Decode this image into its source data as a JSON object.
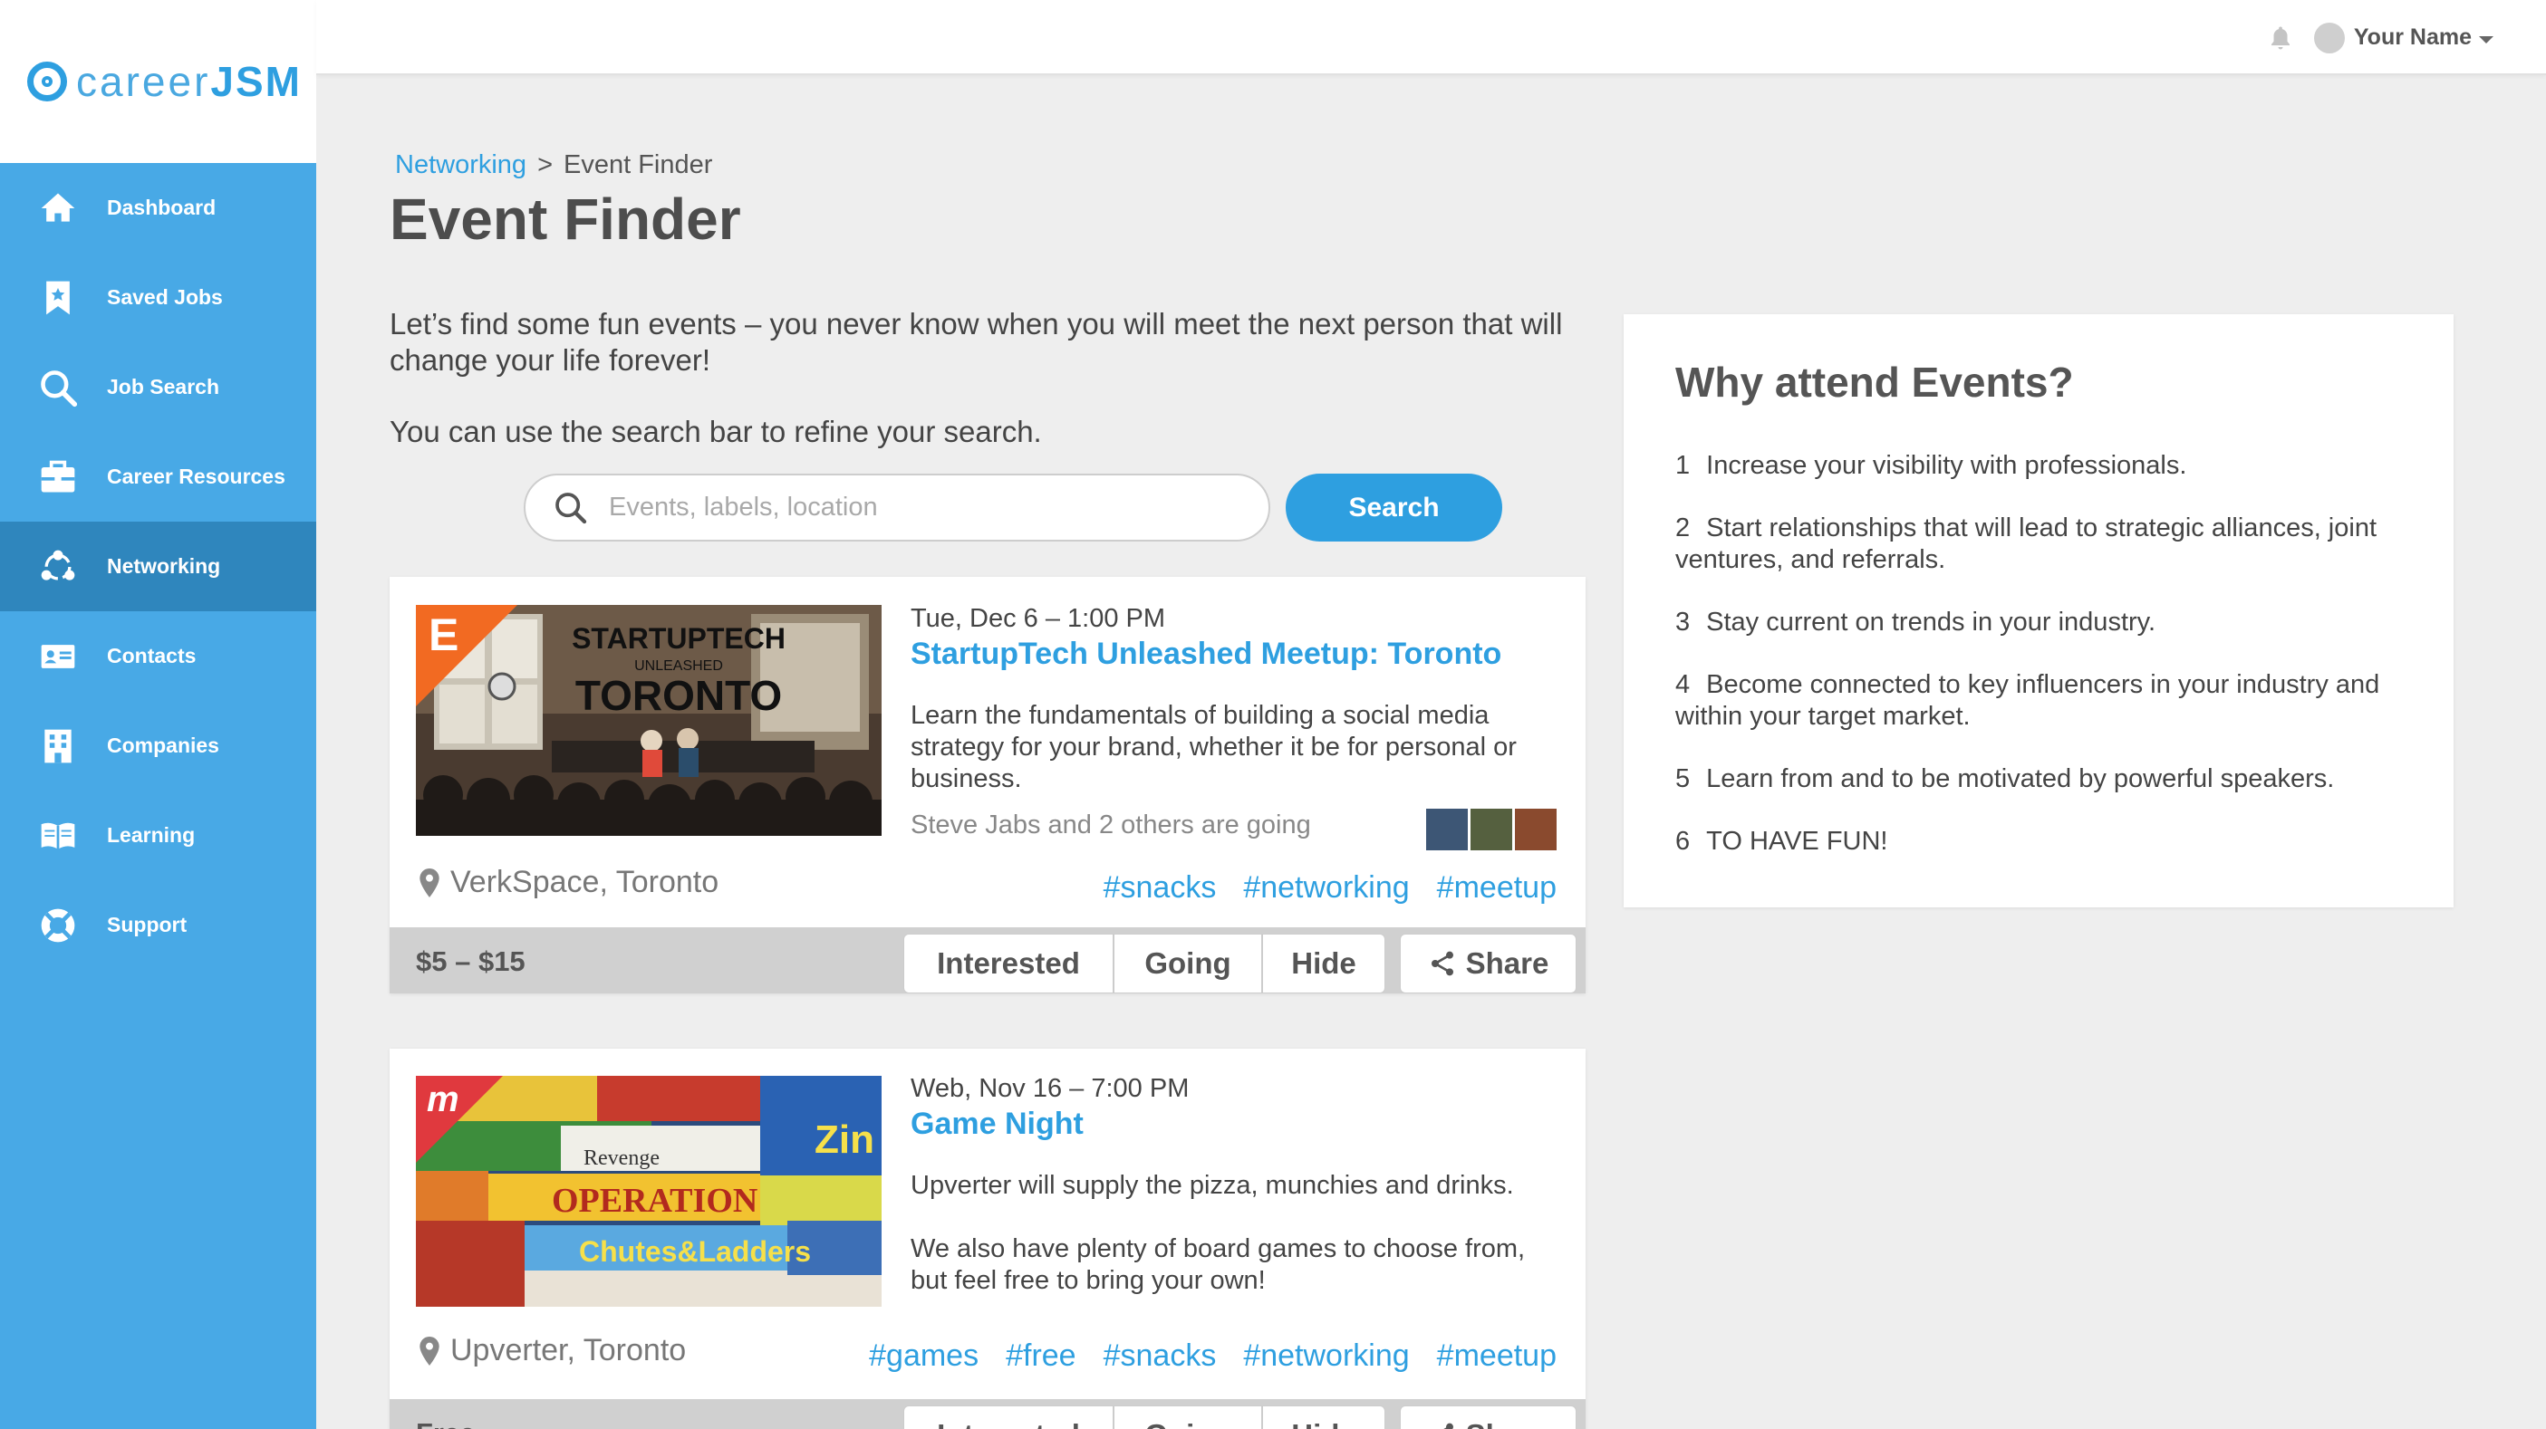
{
  "app": {
    "logo_prefix": "career",
    "logo_suffix": "JSM"
  },
  "sidebar": {
    "items": [
      {
        "label": "Dashboard",
        "icon": "home-icon"
      },
      {
        "label": "Saved Jobs",
        "icon": "bookmark-icon"
      },
      {
        "label": "Job Search",
        "icon": "search-icon"
      },
      {
        "label": "Career Resources",
        "icon": "briefcase-icon"
      },
      {
        "label": "Networking",
        "icon": "network-icon",
        "active": true
      },
      {
        "label": "Contacts",
        "icon": "contact-card-icon"
      },
      {
        "label": "Companies",
        "icon": "building-icon"
      },
      {
        "label": "Learning",
        "icon": "book-icon"
      },
      {
        "label": "Support",
        "icon": "lifebuoy-icon"
      }
    ]
  },
  "topbar": {
    "user_name": "Your Name"
  },
  "breadcrumb": {
    "parent": "Networking",
    "separator": ">",
    "current": "Event Finder"
  },
  "page": {
    "title": "Event Finder",
    "intro": "Let’s find some fun events – you never know when you will meet the next person that will change your life forever!",
    "intro2": "You can use the search bar to refine your search."
  },
  "search": {
    "placeholder": "Events, labels, location",
    "value": "",
    "button_label": "Search"
  },
  "events": [
    {
      "source_badge": "E",
      "date": "Tue, Dec 6 – 1:00 PM",
      "title": "StartupTech Unleashed Meetup: Toronto",
      "description": "Learn the fundamentals of building a social media strategy for your brand, whether it be for personal or business.",
      "going": "Steve Jabs and 2 others are going",
      "location": "VerkSpace, Toronto",
      "tags": [
        "#snacks",
        "#networking",
        "#meetup"
      ],
      "price": "$5 – $15",
      "image_text": {
        "line1": "STARTUPTECH",
        "line2": "UNLEASHED",
        "line3": "TORONTO"
      }
    },
    {
      "source_badge": "m",
      "date": "Web, Nov 16 – 7:00 PM",
      "title": "Game Night",
      "description1": "Upverter will supply the pizza, munchies and drinks.",
      "description2": "We also have plenty of board games to choose from, but feel free to bring your own!",
      "location": "Upverter, Toronto",
      "tags": [
        "#games",
        "#free",
        "#snacks",
        "#networking",
        "#meetup"
      ],
      "price": "Free"
    }
  ],
  "actions": {
    "interested": "Interested",
    "going": "Going",
    "hide": "Hide",
    "share": "Share"
  },
  "why": {
    "title": "Why attend Events?",
    "items": [
      {
        "num": "1",
        "text": "Increase your visibility with professionals."
      },
      {
        "num": "2",
        "text": "Start relationships that will lead to strategic alliances, joint ventures, and referrals."
      },
      {
        "num": "3",
        "text": "Stay current on trends in your industry."
      },
      {
        "num": "4",
        "text": "Become connected to key influencers in your industry and within your target market."
      },
      {
        "num": "5",
        "text": "Learn from and to be motivated by powerful speakers."
      },
      {
        "num": "6",
        "text": "TO HAVE FUN!"
      }
    ]
  },
  "colors": {
    "accent": "#2e9fe0",
    "sidebar": "#48a9e6",
    "sidebar_active": "#2f86bd",
    "eventbrite": "#f26a22",
    "meetup": "#e0393e"
  }
}
